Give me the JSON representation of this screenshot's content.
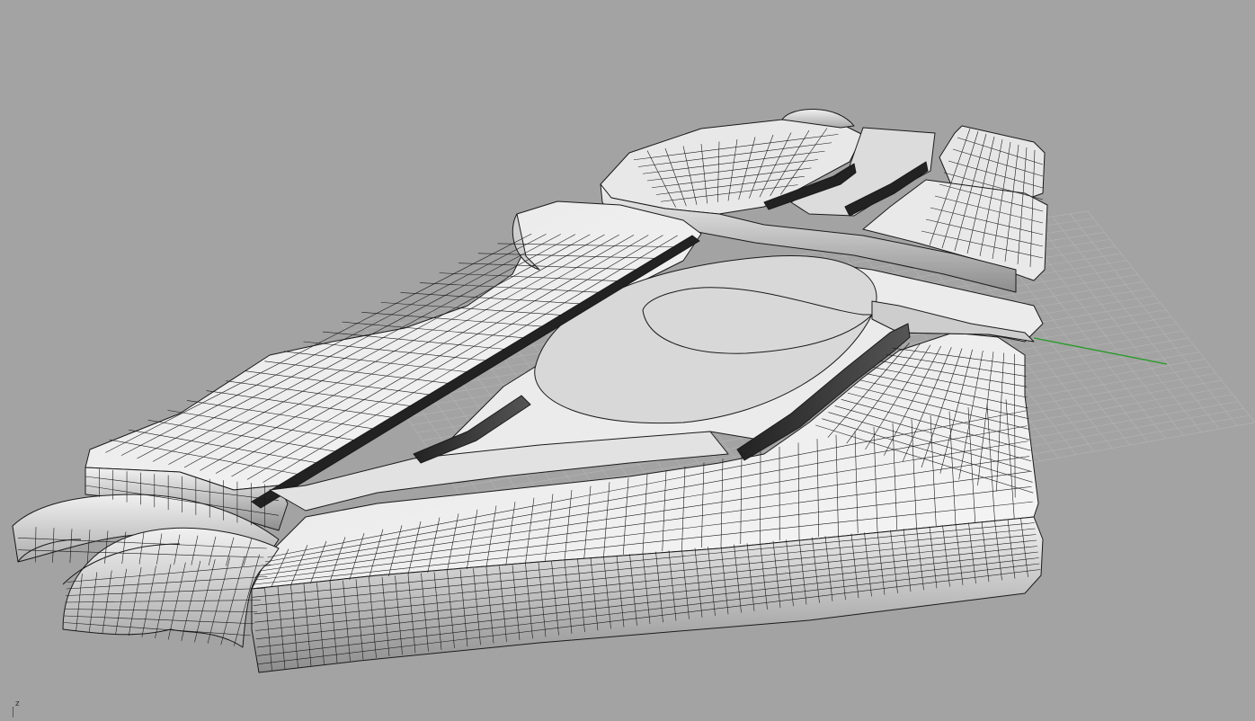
{
  "viewport": {
    "background_color": "#a3a3a3",
    "grid_color": "#b4b4b4",
    "x_axis_color": "#2a9a2a",
    "model_fill": "#ededed",
    "model_shadow": "#6e6e6e",
    "wire_color": "#1a1a1a",
    "axis_gizmo_label": "z"
  }
}
